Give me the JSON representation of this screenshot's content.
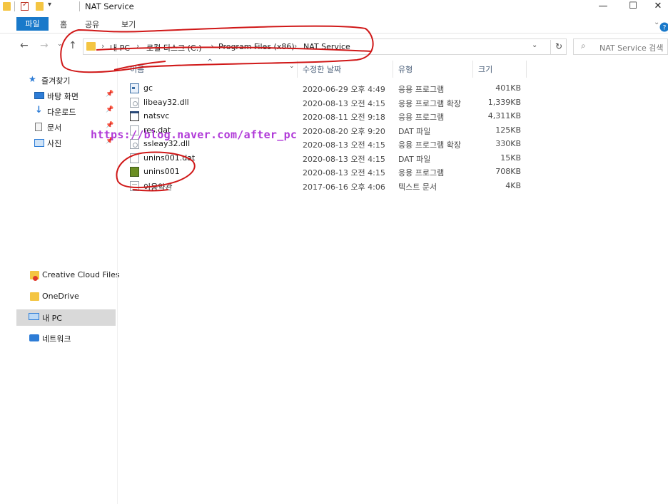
{
  "window": {
    "title": "NAT Service",
    "minimize": "—",
    "maximize": "☐",
    "close": "✕"
  },
  "ribbon": {
    "tabs": [
      "파일",
      "홈",
      "공유",
      "보기"
    ]
  },
  "address": {
    "crumbs": [
      "내 PC",
      "로컬 디스크 (C:)",
      "Program Files (x86)",
      "NAT Service"
    ],
    "separator": "›"
  },
  "search": {
    "placeholder": "NAT Service 검색"
  },
  "nav": {
    "quick_access": "즐겨찾기",
    "pinned": [
      {
        "label": "바탕 화면",
        "icon": "desktop-icon"
      },
      {
        "label": "다운로드",
        "icon": "download-icon"
      },
      {
        "label": "문서",
        "icon": "documents-icon"
      },
      {
        "label": "사진",
        "icon": "pictures-icon"
      }
    ],
    "creative_cloud": "Creative Cloud Files",
    "onedrive": "OneDrive",
    "this_pc": "내 PC",
    "network": "네트워크"
  },
  "columns": {
    "name": "이름",
    "date": "수정한 날짜",
    "type": "유형",
    "size": "크기"
  },
  "files": [
    {
      "name": "gc",
      "date": "2020-06-29 오후 4:49",
      "type": "응용 프로그램",
      "size": "401KB",
      "icon": "application-icon"
    },
    {
      "name": "libeay32.dll",
      "date": "2020-08-13 오전 4:15",
      "type": "응용 프로그램 확장",
      "size": "1,339KB",
      "icon": "dll-icon"
    },
    {
      "name": "natsvc",
      "date": "2020-08-11 오전 9:18",
      "type": "응용 프로그램",
      "size": "4,311KB",
      "icon": "window-app-icon"
    },
    {
      "name": "res.dat",
      "date": "2020-08-20 오후 9:20",
      "type": "DAT 파일",
      "size": "125KB",
      "icon": "dat-file-icon"
    },
    {
      "name": "ssleay32.dll",
      "date": "2020-08-13 오전 4:15",
      "type": "응용 프로그램 확장",
      "size": "330KB",
      "icon": "dll-icon"
    },
    {
      "name": "unins001.dat",
      "date": "2020-08-13 오전 4:15",
      "type": "DAT 파일",
      "size": "15KB",
      "icon": "dat-file-icon"
    },
    {
      "name": "unins001",
      "date": "2020-08-13 오전 4:15",
      "type": "응용 프로그램",
      "size": "708KB",
      "icon": "uninstaller-icon"
    },
    {
      "name": "이용약관",
      "date": "2017-06-16 오후 4:06",
      "type": "텍스트 문서",
      "size": "4KB",
      "icon": "text-file-icon"
    }
  ],
  "watermark": "https://blog.naver.com/after_pc",
  "colors": {
    "accent": "#1979ca",
    "annotation_red": "#d01818",
    "watermark_purple": "#b03ad8",
    "selection": "#d9d9d9"
  }
}
